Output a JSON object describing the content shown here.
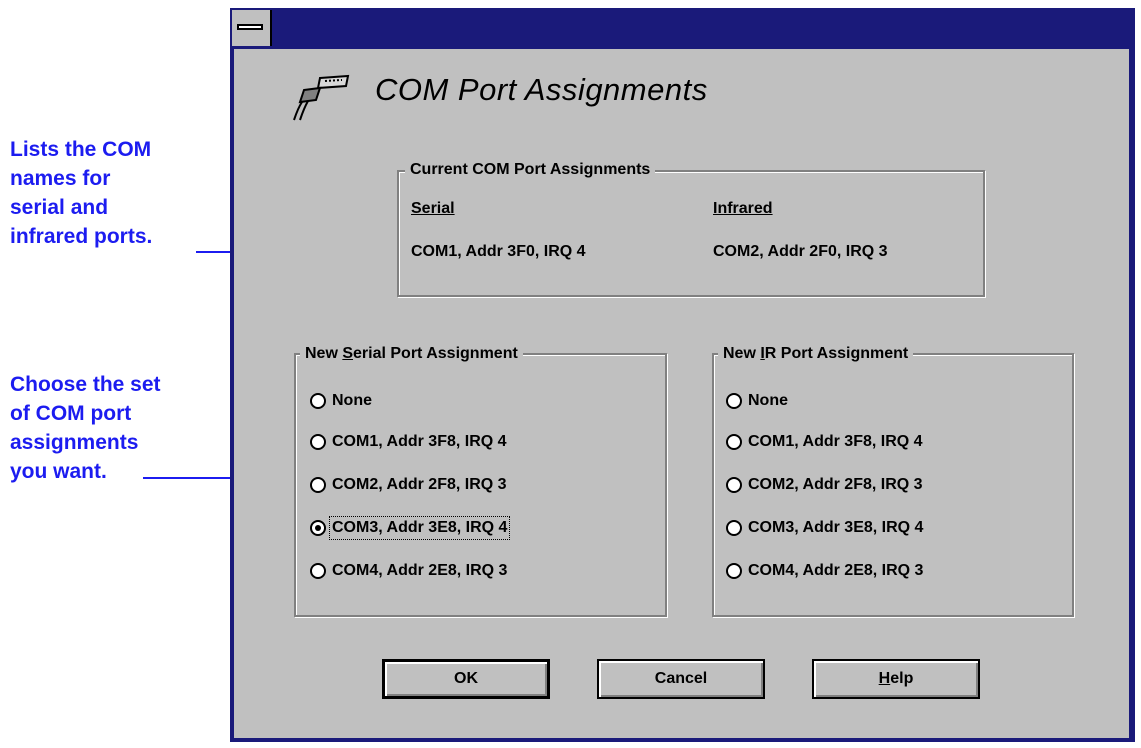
{
  "annotations": {
    "current_lines": [
      "Lists the COM",
      "names for",
      "serial and",
      "infrared ports."
    ],
    "choose_lines": [
      "Choose the set",
      "of COM port",
      "assignments",
      "you want."
    ]
  },
  "dialog": {
    "title": "COM Port Assignments",
    "current_group": {
      "label": "Current COM Port Assignments",
      "serial_header": "Serial",
      "infrared_header": "Infrared",
      "serial_value": "COM1, Addr 3F0, IRQ 4",
      "infrared_value": "COM2, Addr 2F0, IRQ 3"
    },
    "serial_group": {
      "label_prefix": "New ",
      "label_accel": "S",
      "label_suffix": "erial Port Assignment",
      "options": [
        "None",
        "COM1, Addr 3F8, IRQ 4",
        "COM2, Addr 2F8, IRQ 3",
        "COM3, Addr 3E8, IRQ 4",
        "COM4, Addr 2E8, IRQ 3"
      ],
      "selected_index": 3
    },
    "ir_group": {
      "label_prefix": "New ",
      "label_accel": "I",
      "label_suffix": "R Port Assignment",
      "options": [
        "None",
        "COM1, Addr 3F8, IRQ 4",
        "COM2, Addr 2F8, IRQ 3",
        "COM3, Addr 3E8, IRQ 4",
        "COM4, Addr 2E8, IRQ 3"
      ],
      "selected_index": -1
    },
    "buttons": {
      "ok": "OK",
      "cancel": "Cancel",
      "help_accel": "H",
      "help_rest": "elp"
    }
  },
  "icons": {
    "system_menu": "system-menu-icon",
    "port": "serial-cable-icon"
  }
}
